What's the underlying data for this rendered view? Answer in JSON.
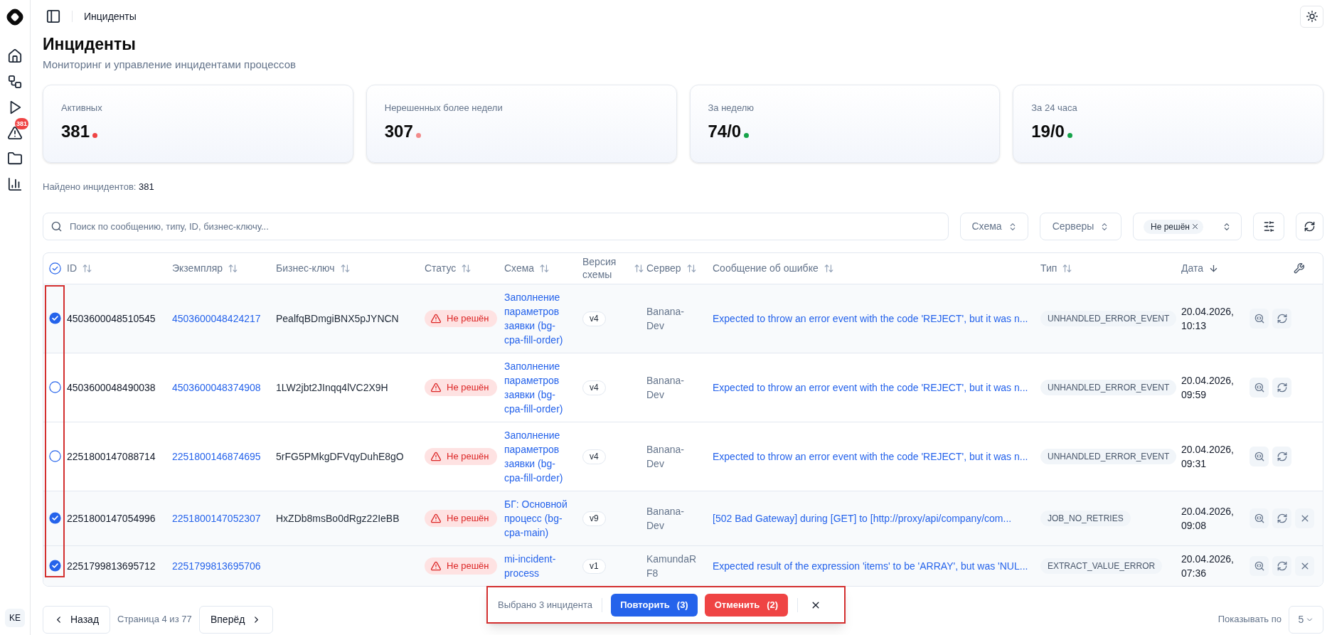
{
  "sidebar": {
    "incidents_badge": "381",
    "user_initials": "KE"
  },
  "header": {
    "breadcrumb": "Инциденты"
  },
  "page": {
    "title": "Инциденты",
    "subtitle": "Мониторинг и управление инцидентами процессов"
  },
  "stats": [
    {
      "label": "Активных",
      "value": "381",
      "color": "#ef4444"
    },
    {
      "label": "Нерешенных более недели",
      "value": "307",
      "color": "#f28b8b"
    },
    {
      "label": "За неделю",
      "value": "74/0",
      "color": "#16a34a"
    },
    {
      "label": "За 24 часа",
      "value": "19/0",
      "color": "#16a34a"
    }
  ],
  "results": {
    "label": "Найдено инцидентов:",
    "count": "381"
  },
  "filters": {
    "search": {
      "placeholder": "Поиск по сообщению, типу, ID, бизнес-ключу..."
    },
    "dropdowns": [
      {
        "label": "Схема"
      },
      {
        "label": "Серверы"
      }
    ],
    "status_chips": [
      "Не решён"
    ]
  },
  "table": {
    "select_all": {
      "partial": true
    },
    "columns": [
      {
        "label": "ID",
        "sorted": false
      },
      {
        "label": "Экземпляр",
        "sorted": false
      },
      {
        "label": "Бизнес-ключ",
        "sorted": false
      },
      {
        "label": "Статус",
        "sorted": false
      },
      {
        "label": "Схема",
        "sorted": false
      },
      {
        "label": "Версия схемы",
        "sorted": false
      },
      {
        "label": "Сервер",
        "sorted": false
      },
      {
        "label": "Сообщение об ошибке",
        "sorted": false
      },
      {
        "label": "Тип",
        "sorted": false
      },
      {
        "label": "Дата",
        "sorted": true
      }
    ],
    "rows": [
      {
        "selected": true,
        "id": "4503600048510545",
        "instance": "4503600048424217",
        "business_key": "PealfqBDmgiBNX5pJYNCN",
        "status": "Не решён",
        "schema": "Заполнение параметров заявки (bg-cpa-fill-order)",
        "version": "v4",
        "server": "Banana-Dev",
        "message": "Expected to throw an error event with the code 'REJECT', but it was n...",
        "type": "UNHANDLED_ERROR_EVENT",
        "date": "20.04.2026, 10:13",
        "actions": [
          {
            "kind": "inspect"
          },
          {
            "kind": "retry"
          }
        ]
      },
      {
        "selected": false,
        "id": "4503600048490038",
        "instance": "4503600048374908",
        "business_key": "1LW2jbt2JInqq4lVC2X9H",
        "status": "Не решён",
        "schema": "Заполнение параметров заявки (bg-cpa-fill-order)",
        "version": "v4",
        "server": "Banana-Dev",
        "message": "Expected to throw an error event with the code 'REJECT', but it was n...",
        "type": "UNHANDLED_ERROR_EVENT",
        "date": "20.04.2026, 09:59",
        "actions": [
          {
            "kind": "inspect"
          },
          {
            "kind": "retry"
          }
        ]
      },
      {
        "selected": false,
        "id": "2251800147088714",
        "instance": "2251800146874695",
        "business_key": "5rFG5PMkgDFVqyDuhE8gO",
        "status": "Не решён",
        "schema": "Заполнение параметров заявки (bg-cpa-fill-order)",
        "version": "v4",
        "server": "Banana-Dev",
        "message": "Expected to throw an error event with the code 'REJECT', but it was n...",
        "type": "UNHANDLED_ERROR_EVENT",
        "date": "20.04.2026, 09:31",
        "actions": [
          {
            "kind": "inspect"
          },
          {
            "kind": "retry"
          }
        ]
      },
      {
        "selected": true,
        "id": "2251800147054996",
        "instance": "2251800147052307",
        "business_key": "HxZDb8msBo0dRgz22IeBB",
        "status": "Не решён",
        "schema": "БГ: Основной процесс (bg-cpa-main)",
        "version": "v9",
        "server": "Banana-Dev",
        "message": "[502 Bad Gateway] during [GET] to [http://proxy/api/company/com...",
        "type": "JOB_NO_RETRIES",
        "date": "20.04.2026, 09:08",
        "actions": [
          {
            "kind": "inspect"
          },
          {
            "kind": "retry"
          },
          {
            "kind": "cancel"
          }
        ]
      },
      {
        "selected": true,
        "id": "2251799813695712",
        "instance": "2251799813695706",
        "status": "Не решён",
        "schema": "mi-incident-process",
        "version": "v1",
        "server": "KamundaRF8",
        "message": "Expected result of the expression 'items' to be 'ARRAY', but was 'NUL...",
        "type": "EXTRACT_VALUE_ERROR",
        "date": "20.04.2026, 07:36",
        "actions": [
          {
            "kind": "inspect"
          },
          {
            "kind": "retry"
          },
          {
            "kind": "cancel"
          }
        ]
      }
    ]
  },
  "selection_bar": {
    "text": "Выбрано 3 инцидента",
    "retry_button": {
      "label": "Повторить",
      "count": "(3)"
    },
    "cancel_button": {
      "label": "Отменить",
      "count": "(2)"
    }
  },
  "pagination": {
    "prev": "Назад",
    "page_info": "Страница 4 из 77",
    "next": "Вперёд",
    "page_size_label": "Показывать по",
    "page_size": "5"
  }
}
